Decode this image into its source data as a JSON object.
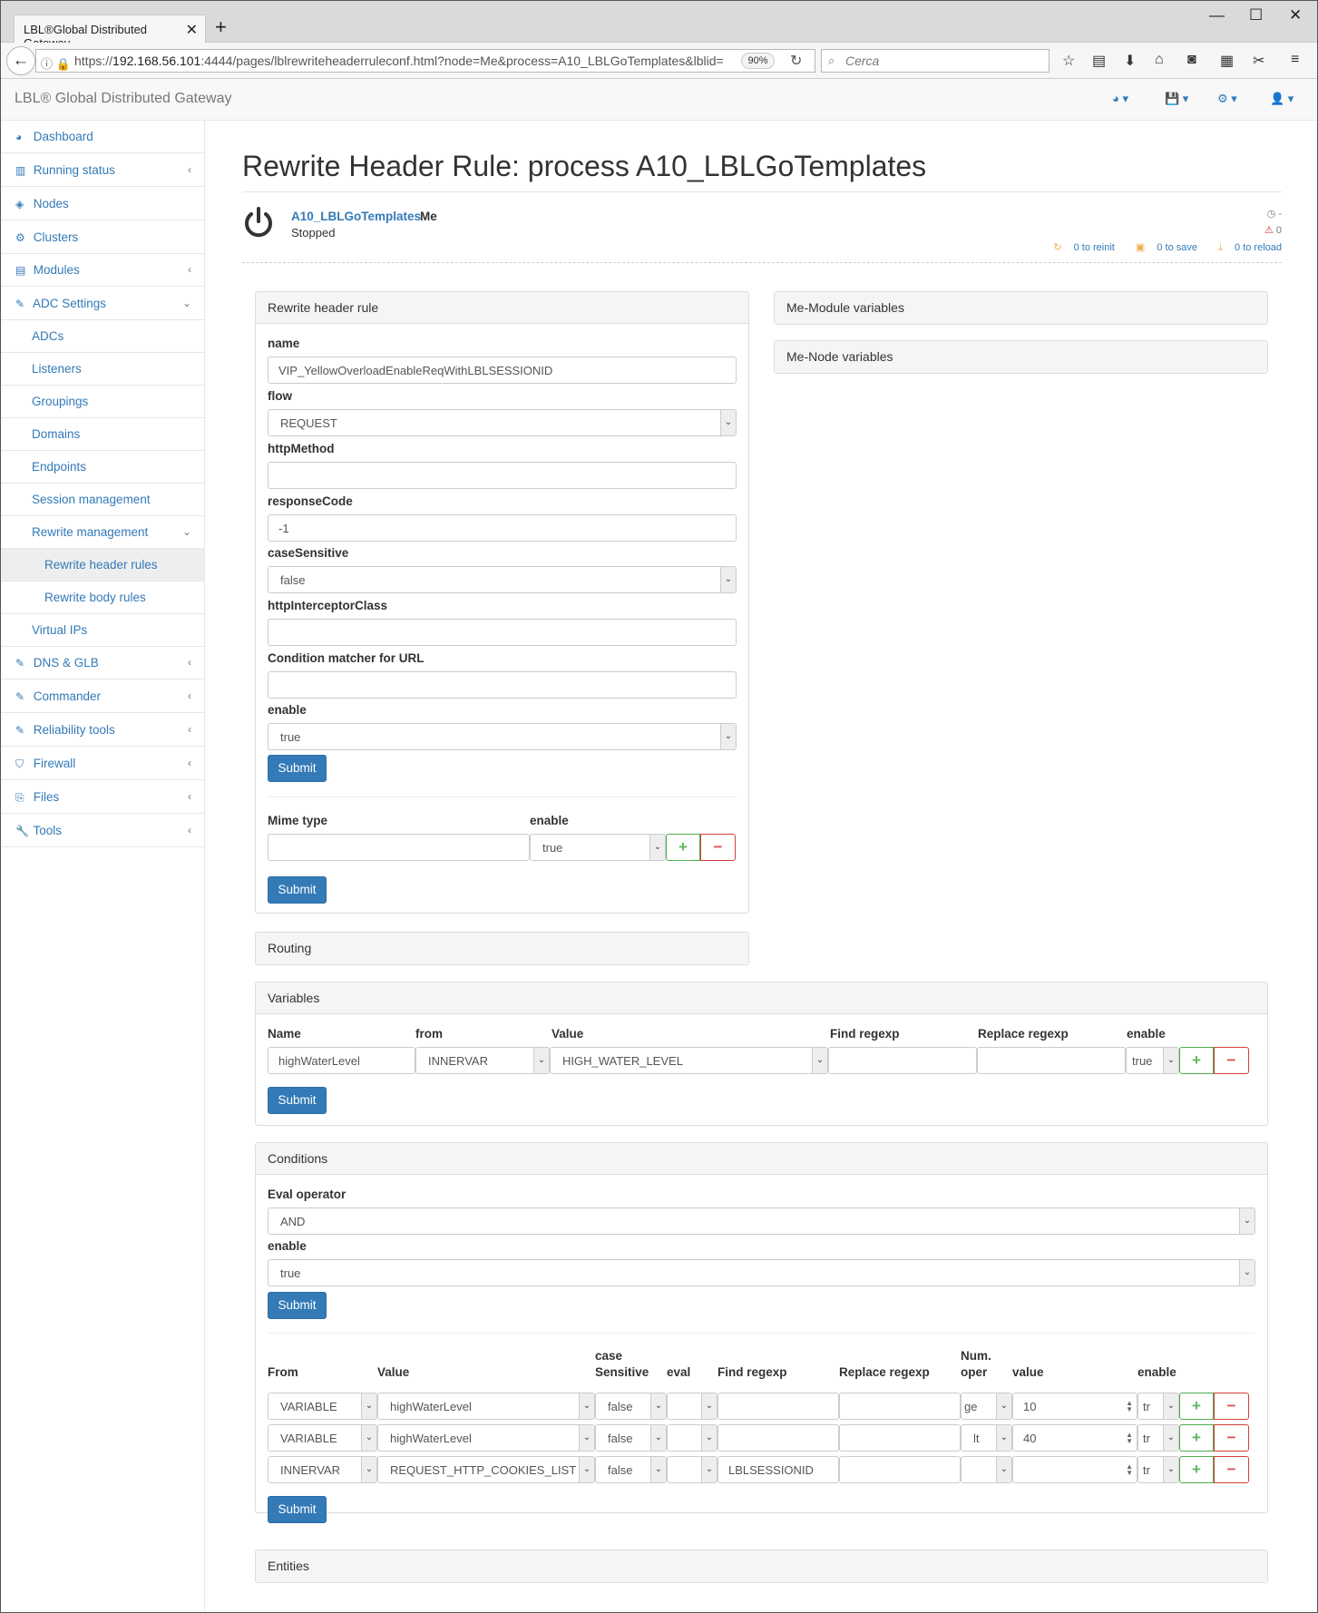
{
  "browser": {
    "tab_title": "LBL®Global Distributed Gateway",
    "url_scheme": "https://",
    "url_host": "192.168.56.101",
    "url_rest": ":4444/pages/lblrewriteheaderruleconf.html?node=Me&process=A10_LBLGoTemplates&lblid=",
    "zoom": "90%",
    "search_placeholder": "Cerca"
  },
  "app": {
    "brand": "LBL® Global Distributed Gateway"
  },
  "sidebar": {
    "items": [
      {
        "label": "Dashboard"
      },
      {
        "label": "Running status"
      },
      {
        "label": "Nodes"
      },
      {
        "label": "Clusters"
      },
      {
        "label": "Modules"
      },
      {
        "label": "ADC Settings"
      },
      {
        "label": "ADCs"
      },
      {
        "label": "Listeners"
      },
      {
        "label": "Groupings"
      },
      {
        "label": "Domains"
      },
      {
        "label": "Endpoints"
      },
      {
        "label": "Session management"
      },
      {
        "label": "Rewrite management"
      },
      {
        "label": "Rewrite header rules"
      },
      {
        "label": "Rewrite body rules"
      },
      {
        "label": "Virtual IPs"
      },
      {
        "label": "DNS & GLB"
      },
      {
        "label": "Commander"
      },
      {
        "label": "Reliability tools"
      },
      {
        "label": "Firewall"
      },
      {
        "label": "Files"
      },
      {
        "label": "Tools"
      }
    ]
  },
  "page": {
    "title": "Rewrite Header Rule: process A10_LBLGoTemplates",
    "process_name": "A10_LBLGoTemplates",
    "node_name": "Me",
    "state": "Stopped",
    "top_right": "-",
    "warn_count": "0",
    "reinit": "0 to reinit",
    "save": "0 to save",
    "reload": "0 to reload"
  },
  "rule_panel": {
    "heading": "Rewrite header rule",
    "name_label": "name",
    "name_value": "VIP_YellowOverloadEnableReqWithLBLSESSIONID",
    "flow_label": "flow",
    "flow_value": "REQUEST",
    "httpmethod_label": "httpMethod",
    "httpmethod_value": "",
    "responsecode_label": "responseCode",
    "responsecode_value": "-1",
    "casesensitive_label": "caseSensitive",
    "casesensitive_value": "false",
    "interceptor_label": "httpInterceptorClass",
    "interceptor_value": "",
    "urlmatcher_label": "Condition matcher for URL",
    "urlmatcher_value": "",
    "enable_label": "enable",
    "enable_value": "true",
    "submit": "Submit",
    "mime_label": "Mime type",
    "mime_enable_label": "enable",
    "mime_value": "",
    "mime_enable_value": "true",
    "submit2": "Submit"
  },
  "side_panels": {
    "module_vars": "Me-Module variables",
    "node_vars": "Me-Node variables"
  },
  "routing": {
    "heading": "Routing"
  },
  "variables": {
    "heading": "Variables",
    "cols": [
      "Name",
      "from",
      "Value",
      "Find regexp",
      "Replace regexp",
      "enable"
    ],
    "row": {
      "name": "highWaterLevel",
      "from": "INNERVAR",
      "value": "HIGH_WATER_LEVEL",
      "find": "",
      "replace": "",
      "enable": "true"
    },
    "submit": "Submit"
  },
  "conditions": {
    "heading": "Conditions",
    "eval_label": "Eval operator",
    "eval_value": "AND",
    "enable_label": "enable",
    "enable_value": "true",
    "submit": "Submit",
    "cols": {
      "from": "From",
      "value": "Value",
      "case1": "case",
      "case2": "Sensitive",
      "eval": "eval",
      "find": "Find regexp",
      "replace": "Replace regexp",
      "num1": "Num.",
      "num2": "oper",
      "val": "value",
      "enable": "enable"
    },
    "rows": [
      {
        "from": "VARIABLE",
        "value": "highWaterLevel",
        "case": "false",
        "eval": "",
        "find": "",
        "replace": "",
        "oper": "ge",
        "val": "10",
        "enable": "tr"
      },
      {
        "from": "VARIABLE",
        "value": "highWaterLevel",
        "case": "false",
        "eval": "",
        "find": "",
        "replace": "",
        "oper": "lt",
        "val": "40",
        "enable": "tr"
      },
      {
        "from": "INNERVAR",
        "value": "REQUEST_HTTP_COOKIES_LIST",
        "case": "false",
        "eval": "",
        "find": "LBLSESSIONID",
        "replace": "",
        "oper": "",
        "val": "",
        "enable": "tr"
      }
    ],
    "submit2": "Submit"
  },
  "entities": {
    "heading": "Entities"
  },
  "colors": {
    "link": "#337ab7",
    "primary": "#337ab7",
    "success": "#5cb85c",
    "danger": "#d9534f"
  }
}
